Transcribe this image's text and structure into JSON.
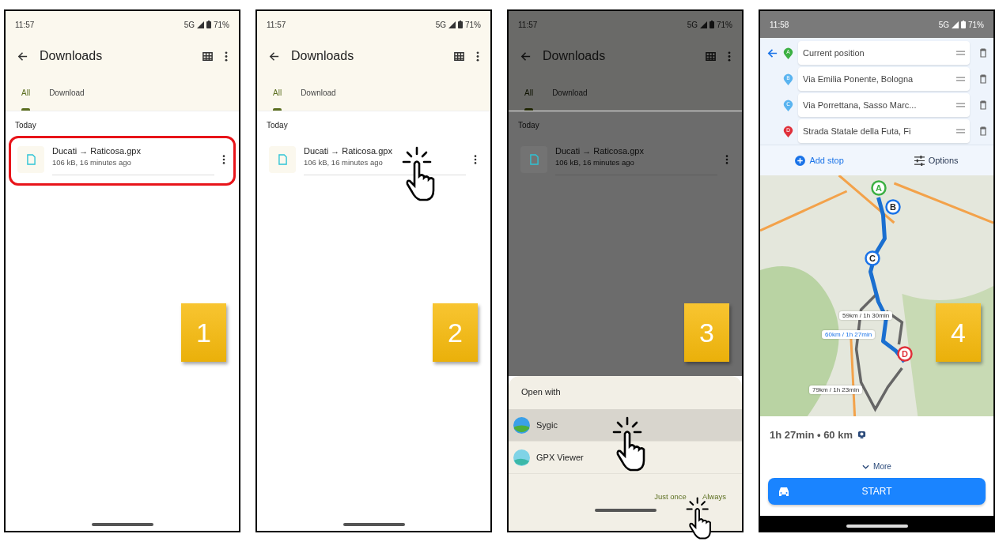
{
  "steps": [
    {
      "number": "1",
      "kind": "files",
      "status": {
        "time": "11:57",
        "network": "5G",
        "battery": "71%"
      },
      "title": "Downloads",
      "tabs": [
        {
          "label": "All",
          "selected": true
        },
        {
          "label": "Download",
          "selected": false
        }
      ],
      "section": "Today",
      "file": {
        "name": "Ducati → Raticosa.gpx",
        "meta": "106 kB, 16 minutes ago",
        "highlighted": true,
        "tapped": false
      }
    },
    {
      "number": "2",
      "kind": "files",
      "status": {
        "time": "11:57",
        "network": "5G",
        "battery": "71%"
      },
      "title": "Downloads",
      "tabs": [
        {
          "label": "All",
          "selected": true
        },
        {
          "label": "Download",
          "selected": false
        }
      ],
      "section": "Today",
      "file": {
        "name": "Ducati → Raticosa.gpx",
        "meta": "106 kB, 16 minutes ago",
        "highlighted": false,
        "tapped": true
      }
    },
    {
      "number": "3",
      "kind": "open_with",
      "status": {
        "time": "11:57",
        "network": "5G",
        "battery": "71%"
      },
      "title": "Downloads",
      "tabs": [
        {
          "label": "All",
          "selected": true
        },
        {
          "label": "Download",
          "selected": false
        }
      ],
      "section": "Today",
      "file": {
        "name": "Ducati → Raticosa.gpx",
        "meta": "106 kB, 16 minutes ago",
        "highlighted": false,
        "tapped": false
      },
      "dialog": {
        "title": "Open with",
        "apps": [
          {
            "name": "Sygic",
            "selected": true,
            "tapped": true
          },
          {
            "name": "GPX Viewer",
            "selected": false,
            "tapped": false
          }
        ],
        "actions": [
          {
            "label": "Just once",
            "tapped": false
          },
          {
            "label": "Always",
            "tapped": true
          }
        ]
      }
    },
    {
      "number": "4",
      "kind": "route",
      "status": {
        "time": "11:58",
        "network": "5G",
        "battery": "71%"
      },
      "stops": [
        {
          "letter": "A",
          "text": "Current position",
          "color": "#3cb043"
        },
        {
          "letter": "B",
          "text": "Via Emilia Ponente, Bologna",
          "color": "#5ab4f0"
        },
        {
          "letter": "C",
          "text": "Via Porrettana, Sasso Marc...",
          "color": "#5ab4f0"
        },
        {
          "letter": "D",
          "text": "Strada Statale della Futa, Fi",
          "color": "#e0303a"
        }
      ],
      "markers": [
        {
          "letter": "A",
          "kind": "start"
        },
        {
          "letter": "B",
          "kind": "via"
        },
        {
          "letter": "C",
          "kind": "via"
        },
        {
          "letter": "D",
          "kind": "end"
        }
      ],
      "add_stop": "Add stop",
      "options": "Options",
      "routes": [
        {
          "label": "59km / 1h 30min",
          "selected": false
        },
        {
          "label": "60km / 1h 27min",
          "selected": true
        },
        {
          "label": "79km / 1h 23min",
          "selected": false
        }
      ],
      "summary": "1h 27min • 60 km",
      "more": "More",
      "start": "START"
    }
  ]
}
